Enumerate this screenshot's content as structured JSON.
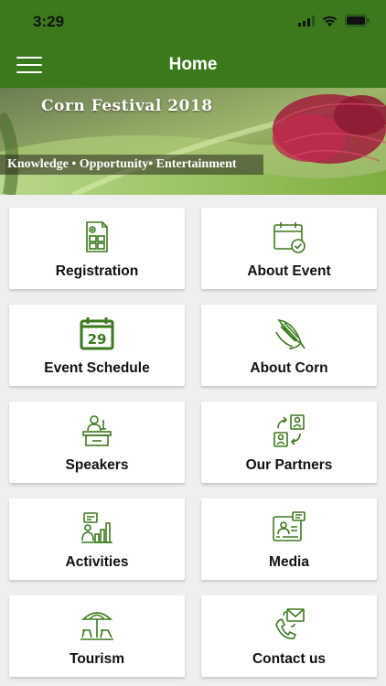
{
  "status": {
    "time": "3:29"
  },
  "header": {
    "title": "Home"
  },
  "banner": {
    "title": "Corn Festival 2018",
    "tagline": "Knowledge • Opportunity• Entertainment"
  },
  "colors": {
    "primary": "#3a7a1c",
    "icon": "#3a7a1c"
  },
  "tiles": [
    {
      "label": "Registration",
      "icon": "registration-form-icon"
    },
    {
      "label": "About Event",
      "icon": "calendar-check-icon"
    },
    {
      "label": "Event Schedule",
      "icon": "calendar-29-icon"
    },
    {
      "label": "About Corn",
      "icon": "corn-icon"
    },
    {
      "label": "Speakers",
      "icon": "speaker-podium-icon"
    },
    {
      "label": "Our Partners",
      "icon": "partners-icon"
    },
    {
      "label": "Activities",
      "icon": "activities-chart-icon"
    },
    {
      "label": "Media",
      "icon": "media-screen-icon"
    },
    {
      "label": "Tourism",
      "icon": "beach-umbrella-icon"
    },
    {
      "label": "Contact us",
      "icon": "contact-phone-mail-icon"
    }
  ]
}
